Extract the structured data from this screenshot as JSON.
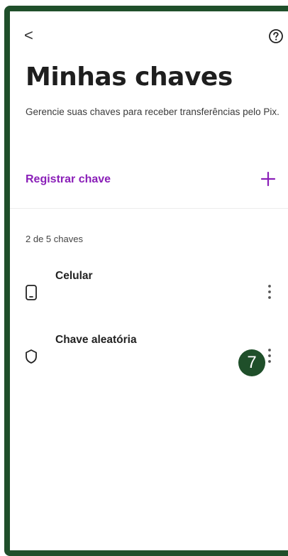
{
  "header": {
    "back_glyph": "<",
    "back_icon": "chevron-left-icon",
    "help_icon": "question-circle-icon"
  },
  "page": {
    "title": "Minhas chaves",
    "subtitle": "Gerencie suas chaves para receber transferências pelo Pix."
  },
  "register": {
    "label": "Registrar chave",
    "icon": "plus-icon"
  },
  "keys": {
    "count_label": "2 de 5 chaves",
    "items": [
      {
        "label": "Celular",
        "icon": "phone-icon"
      },
      {
        "label": "Chave aleatória",
        "icon": "shield-icon"
      }
    ]
  },
  "annotation": {
    "step": "7"
  },
  "colors": {
    "accent": "#8a1fb8",
    "frame": "#1f4f2a",
    "text": "#1e1e1e"
  }
}
